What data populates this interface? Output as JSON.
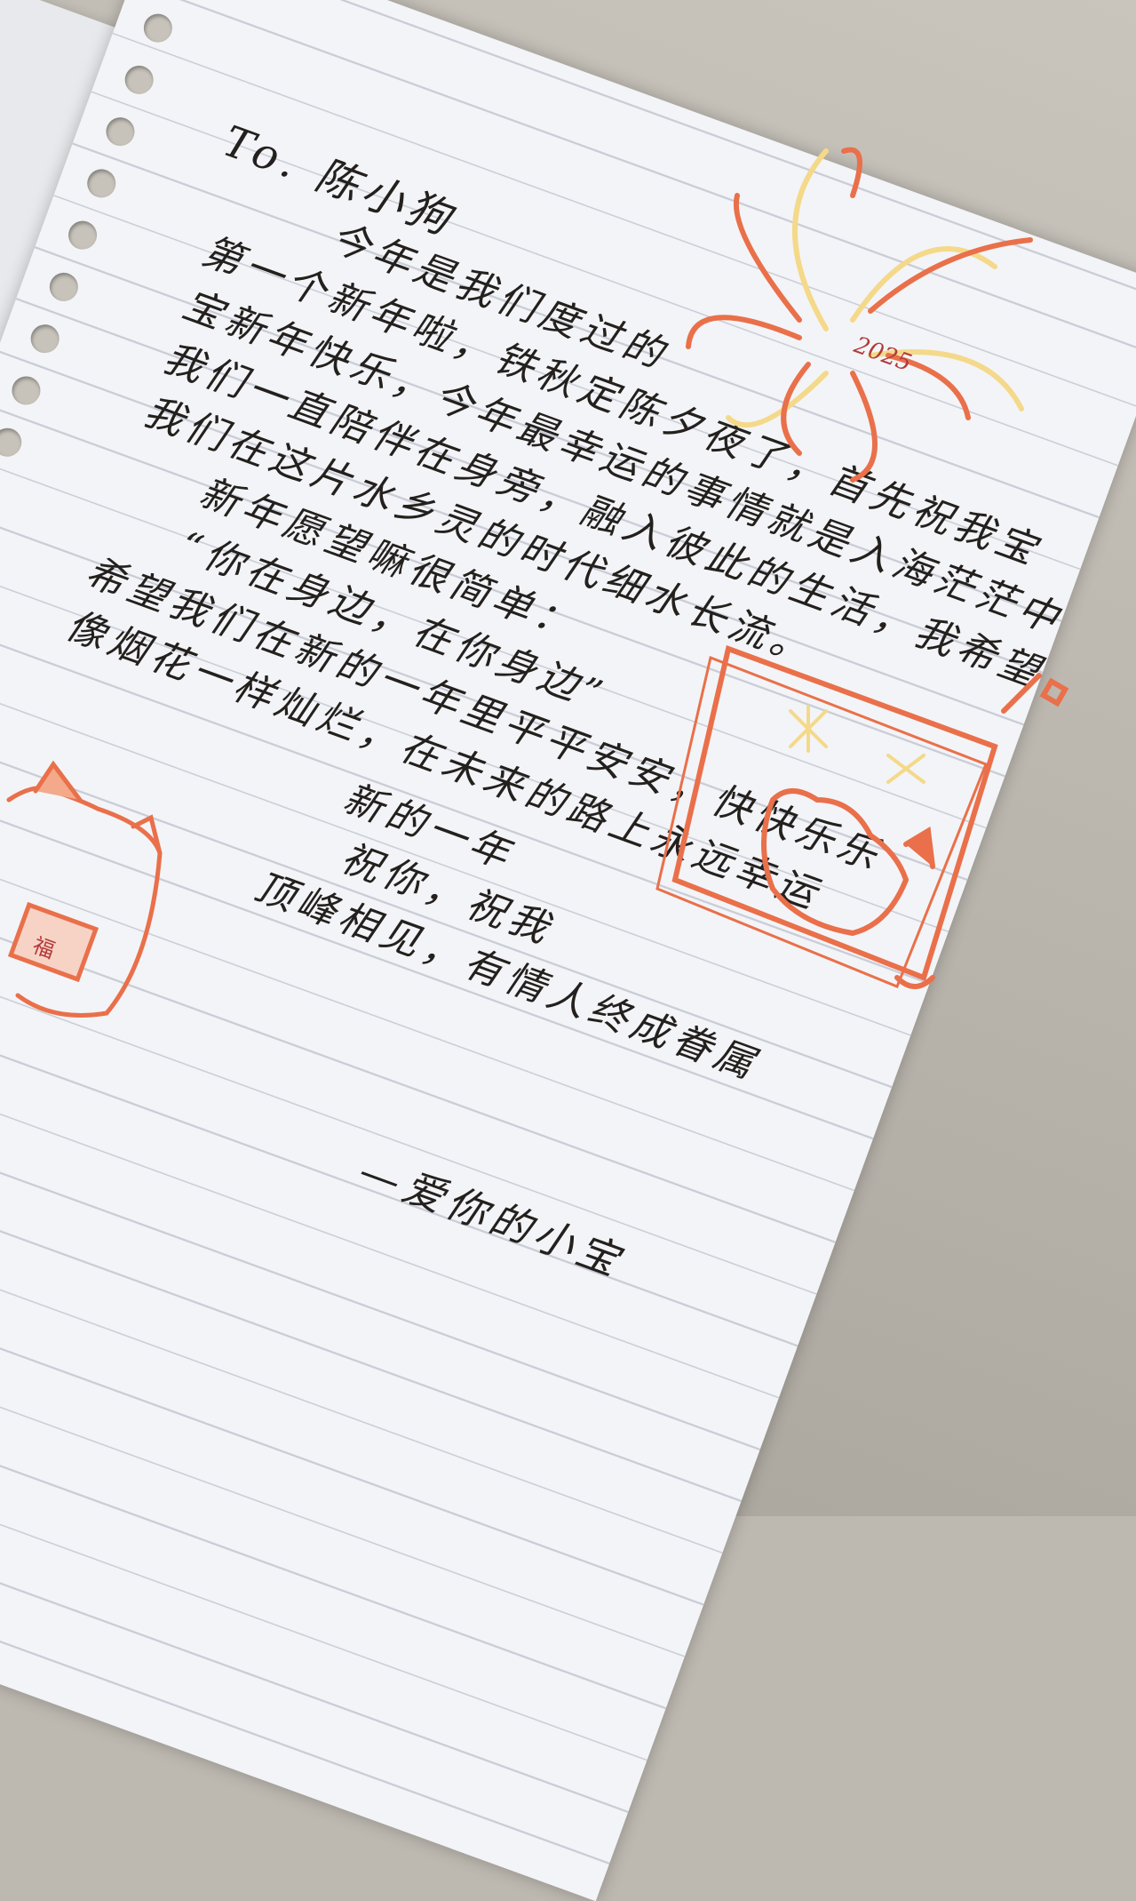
{
  "letter": {
    "salutation": "To. 陈小狗",
    "lines": [
      "今年是我们度过的",
      "第一个新年啦，铁秋定陈夕夜了，首先祝我宝",
      "宝新年快乐，今年最幸运的事情就是入海茫茫中",
      "我们一直陪伴在身旁，融入彼此的生活，我希望",
      "我们在这片水乡灵的时代细水长流。",
      "新年愿望嘛很简单：",
      "“你在身边，在你身边”",
      "希望我们在新的一年里平平安安，快快乐乐",
      "像烟花一样灿烂，在未来的路上永远幸运",
      "新的一年",
      "祝你，祝我",
      "顶峰相见，有情人终成眷属"
    ],
    "signature": "—爱你的小宝"
  },
  "doodles": {
    "firework_label": "2025",
    "red_envelope_label": "福",
    "accent_colors": {
      "orange": "#e9704a",
      "yellow": "#f4d98a",
      "ink": "#23201d"
    }
  }
}
